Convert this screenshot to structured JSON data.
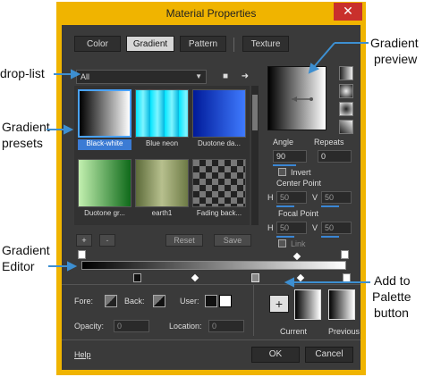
{
  "window": {
    "title": "Material Properties",
    "close_glyph": "✕"
  },
  "tabs": [
    {
      "label": "Color"
    },
    {
      "label": "Gradient"
    },
    {
      "label": "Pattern"
    },
    {
      "label": "Texture"
    }
  ],
  "dropdown": {
    "value": "All"
  },
  "presets": [
    {
      "label": "Black-white",
      "colors": [
        "#000000",
        "#ffffff"
      ]
    },
    {
      "label": "Blue neon",
      "colors": [
        "#00e5ff",
        "#0077cc"
      ]
    },
    {
      "label": "Duotone da...",
      "colors": [
        "#001a99",
        "#3f7bff"
      ]
    },
    {
      "label": "Duotone gr...",
      "colors": [
        "#0f6a1a",
        "#c3f0b0"
      ]
    },
    {
      "label": "earth1",
      "colors": [
        "#5d6b3a",
        "#b7c08e"
      ]
    },
    {
      "label": "Fading back...",
      "colors": [
        "#111111",
        "#999999"
      ]
    }
  ],
  "buttons": {
    "add": "+",
    "remove": "-",
    "reset": "Reset",
    "save": "Save",
    "ok": "OK",
    "cancel": "Cancel",
    "help": "Help",
    "add_to_palette": "+"
  },
  "fields": {
    "angle_label": "Angle",
    "angle_value": "90",
    "repeats_label": "Repeats",
    "repeats_value": "0",
    "invert_label": "Invert",
    "center_point_label": "Center Point",
    "h_label": "H",
    "v_label": "V",
    "center_h": "50",
    "center_v": "50",
    "focal_point_label": "Focal Point",
    "focal_h": "50",
    "focal_v": "50",
    "link_label": "Link",
    "fore_label": "Fore:",
    "back_label": "Back:",
    "user_label": "User:",
    "opacity_label": "Opacity:",
    "opacity_value": "0",
    "location_label": "Location:",
    "location_value": "0",
    "current_label": "Current",
    "previous_label": "Previous"
  },
  "annotations": {
    "drop_list": "drop-list",
    "gradient_presets_1": "Gradient",
    "gradient_presets_2": "presets",
    "gradient_editor_1": "Gradient",
    "gradient_editor_2": "Editor",
    "gradient_preview_1": "Gradient",
    "gradient_preview_2": "preview",
    "add_palette_1": "Add to",
    "add_palette_2": "Palette",
    "add_palette_3": "button"
  },
  "colors": {
    "accent": "#3d8fd1",
    "title_bar": "#f0b400",
    "close": "#c9302c",
    "selection": "#3b7bd4"
  }
}
